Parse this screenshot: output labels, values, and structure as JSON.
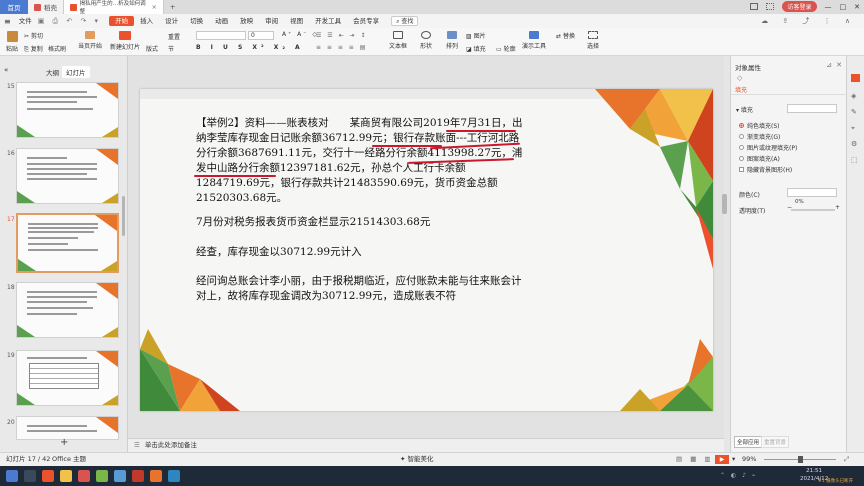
{
  "titlebar": {
    "home_tab": "首页",
    "tabs": [
      {
        "label": "稻壳",
        "color": "#d9534f"
      },
      {
        "label": "揭私用产生的…析及如何调整",
        "color": "#e9522c"
      }
    ],
    "add_tab": "+",
    "login_label": "访客登录"
  },
  "menubar": {
    "file": "文件",
    "items": [
      "开始",
      "插入",
      "设计",
      "切换",
      "动画",
      "放映",
      "审阅",
      "视图",
      "开发工具",
      "会员专享"
    ],
    "active_item": "开始",
    "search": "查找"
  },
  "ribbon": {
    "paste": "粘贴",
    "cut": "剪切",
    "copy": "复制",
    "format_painter": "格式刷",
    "from_start": "当页开始",
    "new_slide": "新建幻灯片",
    "layout": "版式",
    "section": "节",
    "reset": "重置",
    "font_size_a": "0",
    "textbox": "文本框",
    "shape": "形状",
    "arrange": "排列",
    "image": "图片",
    "fill": "填充",
    "outline": "轮廓",
    "presenter": "演示工具",
    "replace": "替换",
    "select": "选择"
  },
  "leftpane": {
    "tab_outline": "大纲",
    "tab_slides": "幻灯片",
    "thumb_numbers": [
      "15",
      "16",
      "17",
      "18",
      "19",
      "20"
    ],
    "selected": "17",
    "add_button": "+"
  },
  "slide": {
    "paragraphs": [
      "【举例2】资料——账表核对　　某商贸有限公司2019年7月31日，出纳李莹库存现金日记账余额36712.99元；银行存款账面---工行河北路分行余额3687691.11元，交行十一经路分行余额4113998.27元，浦发中山路分行余额12397181.62元，孙总个人工行卡余额1284719.69元，银行存款共计21483590.69元，货币资金总额 21520303.68元。",
      "7月份对税务报表货币资金栏显示21514303.68元",
      "经查，库存现金以30712.99元计入",
      "经问询总账会计李小丽，由于报税期临近，应付账款未能与往来账会计对上，故将库存现金调改为30712.99元，造成账表不符"
    ]
  },
  "notes": {
    "placeholder": "单击此处添加备注"
  },
  "rightpane": {
    "title": "对象属性",
    "tab": "填充",
    "section": "填充",
    "options": [
      "纯色填充(S)",
      "渐变填充(G)",
      "图片或纹理填充(P)",
      "图案填充(A)"
    ],
    "selected_option": "纯色填充(S)",
    "hide_bg": "隐藏背景图形(H)",
    "color_label": "颜色(C)",
    "transparency_label": "透明度(T)",
    "transparency_value": "0%",
    "apply_all": "全部应用",
    "reset_bg": "重置背景"
  },
  "statusbar": {
    "slide_info": "幻灯片 17 / 42",
    "theme": "Office 主题",
    "beautify": "智能美化",
    "zoom": "99%"
  },
  "taskbar": {
    "time": "21:51",
    "date": "2021/4/12",
    "tray_text": "#1  摄像头已断开"
  },
  "colors": {
    "accent": "#e9522c",
    "underline": "#c8192d",
    "taskbar": "#1e2a38"
  }
}
